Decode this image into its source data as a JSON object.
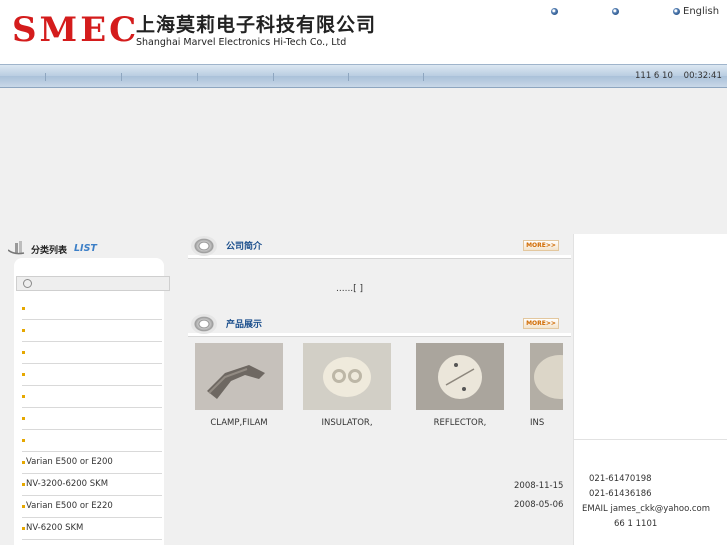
{
  "header": {
    "logo_mark": "SMEC",
    "company_cn": "上海莫莉电子科技有限公司",
    "company_en": "Shanghai Marvel Electronics Hi-Tech Co., Ltd",
    "lang_link": "English"
  },
  "navbar": {
    "date": "111 6 10",
    "time": "00:32:41"
  },
  "left": {
    "title_cn": "分类列表",
    "title_en": "LIST",
    "categories": [
      "",
      "",
      "",
      "",
      "",
      "",
      "",
      "Varian E500 or E200",
      "NV-3200-6200    SKM",
      "Varian E500 or E220",
      "NV-6200    SKM"
    ]
  },
  "center": {
    "about": {
      "title": "公司简介",
      "more": "MORE>>",
      "text": "......[    ]"
    },
    "products": {
      "title": "产品展示",
      "more": "MORE>>",
      "items": [
        {
          "label": "CLAMP,FILAM"
        },
        {
          "label": "INSULATOR,"
        },
        {
          "label": "REFLECTOR,"
        },
        {
          "label": "INS"
        }
      ]
    },
    "dates": [
      "2008-11-15",
      "2008-05-06"
    ]
  },
  "right": {
    "phone1": "021-61470198",
    "phone2": "021-61436186",
    "email": "EMAIL james_ckk@yahoo.com",
    "postcode": "66 1  1101"
  },
  "colors": {
    "logo_red": "#d41c1c",
    "accent_blue": "#3c7fc7",
    "nav_blue": "#b9cde1"
  }
}
